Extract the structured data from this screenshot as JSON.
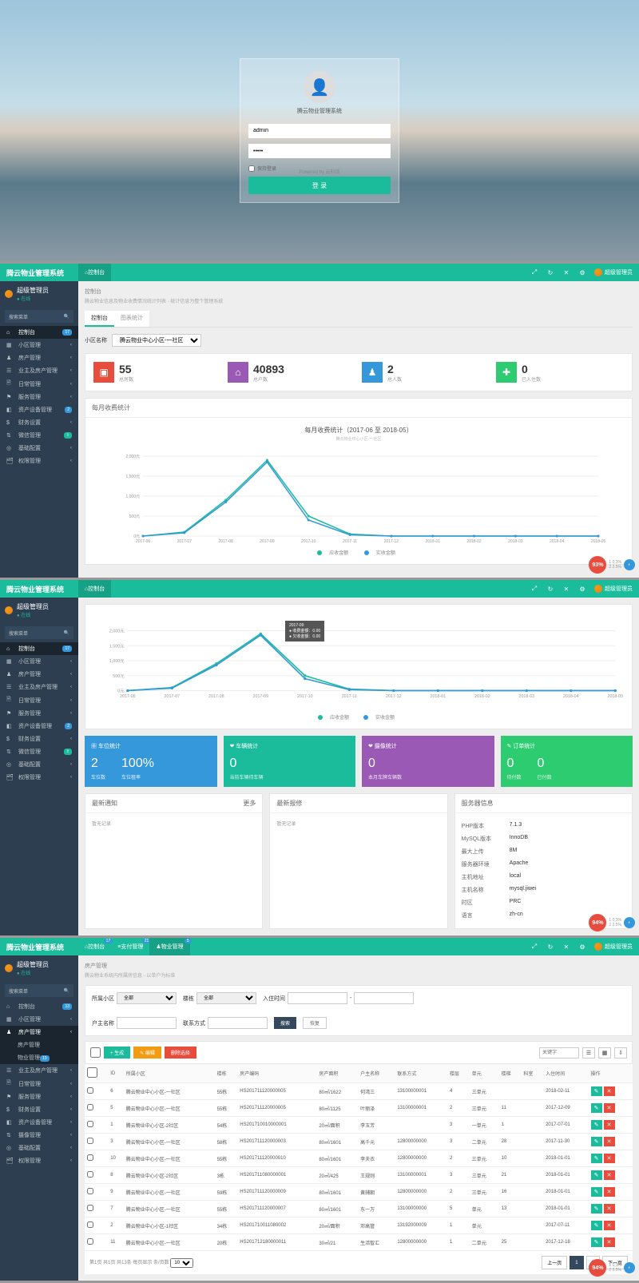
{
  "login": {
    "title": "腾云物业管理系统",
    "username": "admin",
    "password": "•••••",
    "remember": "保持登录",
    "button": "登 录",
    "powered": "Powered by 云科技"
  },
  "header": {
    "logo": "腾云物业管理系统",
    "tab_dashboard": "控制台",
    "tab_payment": "支付管理",
    "tab_property": "物业管理",
    "user": "超级管理员"
  },
  "sidebar": {
    "user": "超级管理员",
    "status": "● 在线",
    "search": "搜索菜单",
    "items": [
      {
        "icon": "⌂",
        "label": "控制台",
        "badge": "17"
      },
      {
        "icon": "▦",
        "label": "小区管理"
      },
      {
        "icon": "♟",
        "label": "房产管理"
      },
      {
        "icon": "☰",
        "label": "业主及房产管理"
      },
      {
        "icon": "🗎",
        "label": "日常管理"
      },
      {
        "icon": "⚑",
        "label": "服务管理"
      },
      {
        "icon": "◧",
        "label": "资产设备管理",
        "badge": "2"
      },
      {
        "icon": "$",
        "label": "财务设置"
      },
      {
        "icon": "⇅",
        "label": "微信管理",
        "badge": "⇧"
      },
      {
        "icon": "◎",
        "label": "基础配置"
      },
      {
        "icon": "🗂",
        "label": "权限管理"
      }
    ],
    "items3": [
      {
        "icon": "⌂",
        "label": "控制台",
        "badge": "13"
      },
      {
        "icon": "▦",
        "label": "小区管理"
      },
      {
        "icon": "♟",
        "label": "房产管理",
        "exp": true
      },
      {
        "icon": "",
        "label": "房产管理",
        "sub": true
      },
      {
        "icon": "",
        "label": "物业管理",
        "sub": true,
        "badge": "13"
      },
      {
        "icon": "☰",
        "label": "业主及房产管理"
      },
      {
        "icon": "🗎",
        "label": "日常管理"
      },
      {
        "icon": "⚑",
        "label": "服务管理"
      },
      {
        "icon": "$",
        "label": "财务设置"
      },
      {
        "icon": "◧",
        "label": "资产设备管理"
      },
      {
        "icon": "⇅",
        "label": "摄像管理"
      },
      {
        "icon": "◎",
        "label": "基础配置"
      },
      {
        "icon": "🗂",
        "label": "权限管理"
      }
    ]
  },
  "dash": {
    "bc": "控制台",
    "bcs": "腾云物业信息及物业收费情况统计列表 - 统计信息为整个管理系统",
    "tab1": "控制台",
    "tab2": "图表统计",
    "sel_label": "小区名称",
    "sel_val": "腾云物业中心小区-一社区",
    "stats": [
      {
        "n": "55",
        "l": "总房数",
        "c": "c-r",
        "i": "▣"
      },
      {
        "n": "40893",
        "l": "总户数",
        "c": "c-p",
        "i": "⌂"
      },
      {
        "n": "2",
        "l": "总人数",
        "c": "c-b",
        "i": "♟"
      },
      {
        "n": "0",
        "l": "已入住数",
        "c": "c-g",
        "i": "✚"
      }
    ],
    "chart_title": "每月收费统计",
    "tooltip": {
      "date": "2017-09",
      "l1": "● 收费金额：0.00",
      "l2": "● 欠收金额：0.00"
    }
  },
  "chart_data": {
    "type": "line",
    "title": "每月收费统计（2017-06 至 2018-05）",
    "subtitle": "腾云物业中心小区-一社区",
    "categories": [
      "2017-06",
      "2017-07",
      "2017-08",
      "2017-09",
      "2017-10",
      "2017-11",
      "2017-12",
      "2018-01",
      "2018-02",
      "2018-03",
      "2018-04",
      "2018-05"
    ],
    "ylim": [
      0,
      2000
    ],
    "yticks": [
      "0元",
      "500元",
      "1,000元",
      "1,500元",
      "2,000元"
    ],
    "series": [
      {
        "name": "应收金额",
        "color": "#1abc9c",
        "values": [
          0,
          100,
          900,
          1900,
          500,
          50,
          0,
          0,
          0,
          0,
          0,
          0
        ]
      },
      {
        "name": "实收金额",
        "color": "#3498db",
        "values": [
          0,
          80,
          850,
          1850,
          400,
          30,
          0,
          0,
          0,
          0,
          0,
          0
        ]
      }
    ]
  },
  "cards": [
    {
      "c": "cb",
      "t": "▦ 车位统计",
      "v": [
        {
          "n": "2",
          "l": "车位数"
        },
        {
          "n": "100%",
          "l": "车位租率"
        }
      ]
    },
    {
      "c": "cg",
      "t": "❤ 车辆统计",
      "v": [
        {
          "n": "0",
          "l": "当前车辆待车辆"
        }
      ]
    },
    {
      "c": "cp",
      "t": "❤ 摄像统计",
      "v": [
        {
          "n": "0",
          "l": "本月车牌车辆数"
        }
      ]
    },
    {
      "c": "cgr",
      "t": "✎ 订单统计",
      "v": [
        {
          "n": "0",
          "l": "待付数"
        },
        {
          "n": "0",
          "l": "已付数"
        }
      ]
    }
  ],
  "panels": {
    "notice": {
      "t": "最新通知",
      "more": "更多",
      "body": "暂无记录"
    },
    "repair": {
      "t": "最新报修",
      "body": "暂无记录"
    },
    "server": {
      "t": "服务器信息",
      "rows": [
        {
          "k": "PHP版本",
          "v": "7.1.3"
        },
        {
          "k": "MySQL版本",
          "v": "InnoDB"
        },
        {
          "k": "最大上传",
          "v": "8M"
        },
        {
          "k": "服务器环境",
          "v": "Apache"
        },
        {
          "k": "主机地址",
          "v": "local"
        },
        {
          "k": "主机名称",
          "v": "mysql.jiwei"
        },
        {
          "k": "时区",
          "v": "PRC"
        },
        {
          "k": "语言",
          "v": "zh-cn"
        }
      ]
    }
  },
  "mgmt": {
    "bc": "房产管理",
    "bcs": "腾云物业系统内所属房信息 - 以单户为标准",
    "filters": {
      "community": "所属小区",
      "all": "全部",
      "floor": "楼栋",
      "created": "入住时间",
      "owner": "户主名称",
      "contact": "联系方式",
      "search": "搜索",
      "reset": "恢复"
    },
    "tools": {
      "add": "+ 生成",
      "export": "✎ 编辑",
      "del": "删除选择",
      "search_ph": "关键字"
    },
    "cols": [
      "ID",
      "所属小区",
      "楼栋",
      "房产编码",
      "房产面积",
      "户主名称",
      "联系方式",
      "楼层",
      "单元",
      "楼梯",
      "科室",
      "入住时间",
      "操作"
    ],
    "rows": [
      {
        "id": "6",
        "xq": "腾云物业中心小区-一社区",
        "ld": "55栋",
        "bm": "HS201711120000005",
        "mj": "80㎡/1622",
        "hz": "何湾三",
        "lx": "13100000001",
        "lc": "4",
        "dy": "三单元",
        "lt": "",
        "ks": "",
        "rz": "2018-02-11"
      },
      {
        "id": "5",
        "xq": "腾云物业中心小区-一社区",
        "ld": "55栋",
        "bm": "HS201711120000005",
        "mj": "80㎡/1125",
        "hz": "叶丽泽",
        "lx": "13100000001",
        "lc": "2",
        "dy": "三单元",
        "lt": "11",
        "ks": "",
        "rz": "2017-12-09"
      },
      {
        "id": "1",
        "xq": "腾云物业中心小区-2社区",
        "ld": "54栋",
        "bm": "HS201710010000001",
        "mj": "20㎡/面积",
        "hz": "李玉芳",
        "lx": "",
        "lc": "3",
        "dy": "一单元",
        "lt": "1",
        "ks": "",
        "rz": "2017-07-01"
      },
      {
        "id": "3",
        "xq": "腾云物业中心小区-一社区",
        "ld": "58栋",
        "bm": "HS201711120000003",
        "mj": "80㎡/1601",
        "hz": "高千元",
        "lx": "12800000000",
        "lc": "3",
        "dy": "二单元",
        "lt": "28",
        "ks": "",
        "rz": "2017-11-30"
      },
      {
        "id": "10",
        "xq": "腾云物业中心小区-一社区",
        "ld": "55栋",
        "bm": "HS201711120000010",
        "mj": "80㎡/1601",
        "hz": "李夫衣",
        "lx": "12800000000",
        "lc": "2",
        "dy": "三单元",
        "lt": "10",
        "ks": "",
        "rz": "2018-01-01"
      },
      {
        "id": "8",
        "xq": "腾云物业中心小区-2社区",
        "ld": "3栋",
        "bm": "HS201711080000001",
        "mj": "20㎡/425",
        "hz": "王规则",
        "lx": "13100000001",
        "lc": "3",
        "dy": "三单元",
        "lt": "21",
        "ks": "",
        "rz": "2018-01-01"
      },
      {
        "id": "9",
        "xq": "腾云物业中心小区-一社区",
        "ld": "59栋",
        "bm": "HS201711120000009",
        "mj": "80㎡/1601",
        "hz": "黄辅朝",
        "lx": "12800000000",
        "lc": "2",
        "dy": "三单元",
        "lt": "16",
        "ks": "",
        "rz": "2018-01-01"
      },
      {
        "id": "7",
        "xq": "腾云物业中心小区-一社区",
        "ld": "55栋",
        "bm": "HS201711120000007",
        "mj": "80㎡/1601",
        "hz": "东一万",
        "lx": "13100000000",
        "lc": "5",
        "dy": "单元",
        "lt": "13",
        "ks": "",
        "rz": "2018-01-01"
      },
      {
        "id": "2",
        "xq": "腾云物业中心小区-1社区",
        "ld": "34栋",
        "bm": "HS201710011080002",
        "mj": "20㎡/面积",
        "hz": "邓高管",
        "lx": "13192000009",
        "lc": "1",
        "dy": "单元",
        "lt": "",
        "ks": "",
        "rz": "2017-07-11"
      },
      {
        "id": "11",
        "xq": "腾云物业中心小区-一社区",
        "ld": "20栋",
        "bm": "HS201712180000011",
        "mj": "30㎡/21",
        "hz": "生活智汇",
        "lx": "12800000000",
        "lc": "1",
        "dy": "二单元",
        "lt": "25",
        "ks": "",
        "rz": "2017-12-18"
      }
    ],
    "pager": {
      "info": "第1页 共1页 共13条 每页显示 条/页数",
      "per": "10",
      "prev": "上一页",
      "p1": "1",
      "p2": "2",
      "next": "下一页"
    }
  },
  "gauge": {
    "pct": "93%",
    "l1": "1  0.3%",
    "l2": "2  2.5%"
  },
  "gauge2": {
    "pct": "94%"
  }
}
